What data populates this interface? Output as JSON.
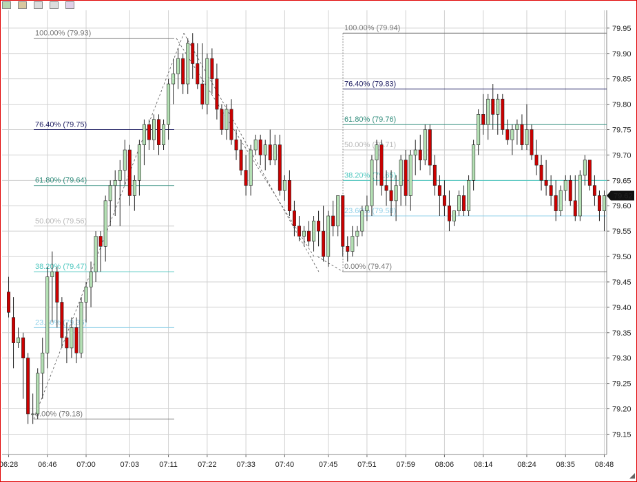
{
  "toolbar": {
    "icons": [
      "chart-type-icon",
      "color-icon",
      "drawing-icon",
      "save-icon",
      "properties-icon"
    ]
  },
  "chart_data": {
    "type": "candlestick",
    "title": "",
    "xlabel": "",
    "ylabel": "",
    "ylim": [
      79.11,
      79.985
    ],
    "grid": true,
    "y_ticks": [
      "79.95",
      "79.90",
      "79.85",
      "79.80",
      "79.75",
      "79.70",
      "79.65",
      "79.60",
      "79.55",
      "79.50",
      "79.45",
      "79.40",
      "79.35",
      "79.30",
      "79.25",
      "79.20",
      "79.15"
    ],
    "x_ticks": [
      "06:28",
      "06:46",
      "07:00",
      "07:03",
      "07:11",
      "07:22",
      "07:33",
      "07:40",
      "07:45",
      "07:51",
      "07:59",
      "08:06",
      "08:14",
      "08:24",
      "08:35",
      "08:48"
    ],
    "last_price": "79.62",
    "colors": {
      "up": "#b4e0b4",
      "down": "#cc0000",
      "grid": "#d0d0d0",
      "frame": "#e00000"
    },
    "candles": [
      [
        79.43,
        79.46,
        79.38,
        79.39
      ],
      [
        79.38,
        79.42,
        79.28,
        79.33
      ],
      [
        79.33,
        79.36,
        79.32,
        79.34
      ],
      [
        79.34,
        79.35,
        79.22,
        79.3
      ],
      [
        79.3,
        79.31,
        79.17,
        79.19
      ],
      [
        79.19,
        79.23,
        79.17,
        79.19
      ],
      [
        79.19,
        79.28,
        79.18,
        79.27
      ],
      [
        79.27,
        79.34,
        79.22,
        79.31
      ],
      [
        79.31,
        79.48,
        79.28,
        79.46
      ],
      [
        79.46,
        79.51,
        79.37,
        79.47
      ],
      [
        79.47,
        79.48,
        79.36,
        79.41
      ],
      [
        79.41,
        79.42,
        79.32,
        79.34
      ],
      [
        79.34,
        79.37,
        79.29,
        79.32
      ],
      [
        79.32,
        79.38,
        79.3,
        79.36
      ],
      [
        79.36,
        79.38,
        79.29,
        79.31
      ],
      [
        79.31,
        79.42,
        79.3,
        79.41
      ],
      [
        79.41,
        79.45,
        79.37,
        79.44
      ],
      [
        79.44,
        79.49,
        79.4,
        79.47
      ],
      [
        79.47,
        79.55,
        79.45,
        79.54
      ],
      [
        79.54,
        79.55,
        79.47,
        79.52
      ],
      [
        79.52,
        79.62,
        79.49,
        79.61
      ],
      [
        79.61,
        79.65,
        79.56,
        79.64
      ],
      [
        79.64,
        79.67,
        79.58,
        79.65
      ],
      [
        79.65,
        79.69,
        79.56,
        79.67
      ],
      [
        79.67,
        79.73,
        79.64,
        79.71
      ],
      [
        79.71,
        79.72,
        79.6,
        79.62
      ],
      [
        79.62,
        79.66,
        79.59,
        79.65
      ],
      [
        79.65,
        79.73,
        79.62,
        79.72
      ],
      [
        79.72,
        79.77,
        79.68,
        79.76
      ],
      [
        79.76,
        79.77,
        79.71,
        79.73
      ],
      [
        79.73,
        79.78,
        79.71,
        79.77
      ],
      [
        79.77,
        79.78,
        79.7,
        79.72
      ],
      [
        79.72,
        79.77,
        79.71,
        79.76
      ],
      [
        79.76,
        79.85,
        79.73,
        79.84
      ],
      [
        79.84,
        79.89,
        79.8,
        79.86
      ],
      [
        79.86,
        79.91,
        79.83,
        79.89
      ],
      [
        79.89,
        79.9,
        79.82,
        79.84
      ],
      [
        79.84,
        79.93,
        79.82,
        79.92
      ],
      [
        79.92,
        79.94,
        79.85,
        79.88
      ],
      [
        79.88,
        79.92,
        79.83,
        79.84
      ],
      [
        79.84,
        79.92,
        79.79,
        79.8
      ],
      [
        79.8,
        79.9,
        79.78,
        79.89
      ],
      [
        79.89,
        79.91,
        79.82,
        79.85
      ],
      [
        79.85,
        79.88,
        79.77,
        79.79
      ],
      [
        79.79,
        79.8,
        79.74,
        79.75
      ],
      [
        79.75,
        79.8,
        79.73,
        79.79
      ],
      [
        79.79,
        79.81,
        79.72,
        79.73
      ],
      [
        79.73,
        79.75,
        79.69,
        79.71
      ],
      [
        79.71,
        79.73,
        79.66,
        79.67
      ],
      [
        79.67,
        79.7,
        79.62,
        79.64
      ],
      [
        79.64,
        79.72,
        79.62,
        79.71
      ],
      [
        79.71,
        79.74,
        79.7,
        79.73
      ],
      [
        79.73,
        79.74,
        79.68,
        79.7
      ],
      [
        79.7,
        79.73,
        79.67,
        79.72
      ],
      [
        79.72,
        79.75,
        79.68,
        79.69
      ],
      [
        79.69,
        79.74,
        79.68,
        79.72
      ],
      [
        79.72,
        79.74,
        79.62,
        79.63
      ],
      [
        79.63,
        79.66,
        79.61,
        79.65
      ],
      [
        79.65,
        79.67,
        79.58,
        79.59
      ],
      [
        79.59,
        79.61,
        79.54,
        79.56
      ],
      [
        79.56,
        79.58,
        79.53,
        79.54
      ],
      [
        79.54,
        79.56,
        79.52,
        79.55
      ],
      [
        79.55,
        79.57,
        79.52,
        79.53
      ],
      [
        79.53,
        79.58,
        79.51,
        79.57
      ],
      [
        79.57,
        79.59,
        79.52,
        79.55
      ],
      [
        79.55,
        79.6,
        79.49,
        79.5
      ],
      [
        79.5,
        79.59,
        79.48,
        79.58
      ],
      [
        79.58,
        79.61,
        79.54,
        79.56
      ],
      [
        79.56,
        79.62,
        79.54,
        79.62
      ],
      [
        79.62,
        79.62,
        79.5,
        79.52
      ],
      [
        79.52,
        79.54,
        79.49,
        79.51
      ],
      [
        79.51,
        79.56,
        79.5,
        79.54
      ],
      [
        79.54,
        79.56,
        79.52,
        79.55
      ],
      [
        79.55,
        79.6,
        79.54,
        79.59
      ],
      [
        79.59,
        79.62,
        79.57,
        79.6
      ],
      [
        79.6,
        79.7,
        79.58,
        79.69
      ],
      [
        79.69,
        79.73,
        79.64,
        79.72
      ],
      [
        79.72,
        79.73,
        79.62,
        79.64
      ],
      [
        79.64,
        79.67,
        79.6,
        79.63
      ],
      [
        79.63,
        79.67,
        79.58,
        79.61
      ],
      [
        79.61,
        79.66,
        79.57,
        79.64
      ],
      [
        79.64,
        79.7,
        79.6,
        79.69
      ],
      [
        79.69,
        79.71,
        79.6,
        79.62
      ],
      [
        79.62,
        79.71,
        79.59,
        79.7
      ],
      [
        79.7,
        79.73,
        79.66,
        79.71
      ],
      [
        79.71,
        79.74,
        79.67,
        79.69
      ],
      [
        79.69,
        79.76,
        79.68,
        79.75
      ],
      [
        79.75,
        79.76,
        79.66,
        79.68
      ],
      [
        79.68,
        79.7,
        79.62,
        79.64
      ],
      [
        79.64,
        79.66,
        79.58,
        79.62
      ],
      [
        79.62,
        79.65,
        79.58,
        79.6
      ],
      [
        79.6,
        79.63,
        79.55,
        79.57
      ],
      [
        79.57,
        79.59,
        79.56,
        79.59
      ],
      [
        79.59,
        79.63,
        79.58,
        79.62
      ],
      [
        79.62,
        79.64,
        79.58,
        79.59
      ],
      [
        79.59,
        79.66,
        79.58,
        79.65
      ],
      [
        79.65,
        79.73,
        79.63,
        79.72
      ],
      [
        79.72,
        79.79,
        79.7,
        79.78
      ],
      [
        79.78,
        79.82,
        79.74,
        79.76
      ],
      [
        79.76,
        79.82,
        79.73,
        79.81
      ],
      [
        79.81,
        79.84,
        79.75,
        79.78
      ],
      [
        79.78,
        79.82,
        79.74,
        79.81
      ],
      [
        79.81,
        79.82,
        79.74,
        79.75
      ],
      [
        79.75,
        79.77,
        79.72,
        79.73
      ],
      [
        79.73,
        79.76,
        79.7,
        79.75
      ],
      [
        79.75,
        79.77,
        79.72,
        79.76
      ],
      [
        79.76,
        79.78,
        79.71,
        79.72
      ],
      [
        79.72,
        79.8,
        79.71,
        79.75
      ],
      [
        79.75,
        79.76,
        79.69,
        79.7
      ],
      [
        79.7,
        79.73,
        79.66,
        79.68
      ],
      [
        79.68,
        79.7,
        79.63,
        79.65
      ],
      [
        79.65,
        79.69,
        79.62,
        79.64
      ],
      [
        79.64,
        79.66,
        79.6,
        79.62
      ],
      [
        79.62,
        79.65,
        79.57,
        79.59
      ],
      [
        79.59,
        79.64,
        79.58,
        79.63
      ],
      [
        79.63,
        79.66,
        79.61,
        79.65
      ],
      [
        79.65,
        79.66,
        79.6,
        79.61
      ],
      [
        79.61,
        79.66,
        79.57,
        79.58
      ],
      [
        79.58,
        79.67,
        79.57,
        79.66
      ],
      [
        79.66,
        79.7,
        79.64,
        79.69
      ],
      [
        79.69,
        79.69,
        79.63,
        79.64
      ],
      [
        79.64,
        79.66,
        79.6,
        79.62
      ],
      [
        79.62,
        79.63,
        79.57,
        79.59
      ],
      [
        79.59,
        79.63,
        79.55,
        79.62
      ]
    ],
    "fibonacci": [
      {
        "name": "fib-set-1",
        "levels": [
          {
            "label": "100.00% (79.93)",
            "value": 79.93,
            "color": "#777777"
          },
          {
            "label": "76.40% (79.75)",
            "value": 79.75,
            "color": "#1c1c60"
          },
          {
            "label": "61.80% (79.64)",
            "value": 79.64,
            "color": "#2e8b7a"
          },
          {
            "label": "50.00% (79.56)",
            "value": 79.56,
            "color": "#c8c8c8"
          },
          {
            "label": "38.20% (79.47)",
            "value": 79.47,
            "color": "#50c8c0"
          },
          {
            "label": "23.60% (79.36)",
            "value": 79.36,
            "color": "#90d0e8"
          },
          {
            "label": "0.00% (79.18)",
            "value": 79.18,
            "color": "#777777"
          }
        ]
      },
      {
        "name": "fib-set-2",
        "levels": [
          {
            "label": "100.00% (79.94)",
            "value": 79.94,
            "color": "#777777"
          },
          {
            "label": "76.40% (79.83)",
            "value": 79.83,
            "color": "#1c1c60"
          },
          {
            "label": "61.80% (79.76)",
            "value": 79.76,
            "color": "#2e8b7a"
          },
          {
            "label": "50.00% (79.71)",
            "value": 79.71,
            "color": "#c8c8c8"
          },
          {
            "label": "38.20% (79.65)",
            "value": 79.65,
            "color": "#50c8c0"
          },
          {
            "label": "23.60% (79.58)",
            "value": 79.58,
            "color": "#90d0e8"
          },
          {
            "label": "0.00% (79.47)",
            "value": 79.47,
            "color": "#777777"
          }
        ]
      }
    ]
  }
}
